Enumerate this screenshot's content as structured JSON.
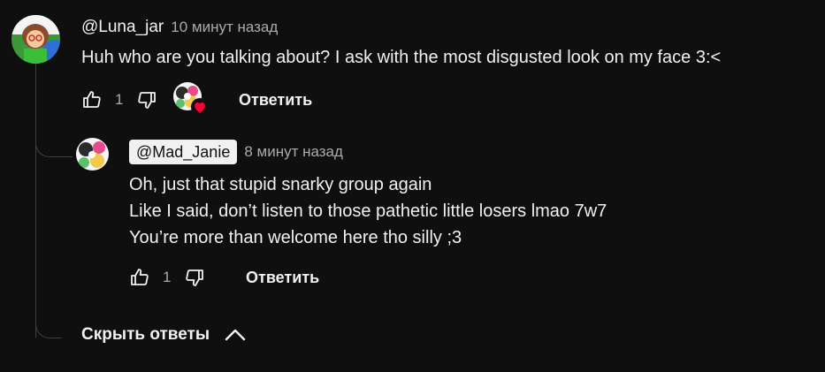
{
  "comment": {
    "handle": "@Luna_jar",
    "time": "10 минут назад",
    "text": "Huh who are you talking about? I ask with the most disgusted look on my face 3:<",
    "likes": "1",
    "reply_label": "Ответить"
  },
  "reply": {
    "handle": "@Mad_Janie",
    "time": "8 минут назад",
    "lines": [
      "Oh, just that stupid snarky group again",
      "Like I said, don’t listen to those pathetic little losers lmao 7w7",
      "You’re more than welcome here tho silly ;3"
    ],
    "likes": "1",
    "reply_label": "Ответить"
  },
  "hide_replies_label": "Скрыть ответы",
  "icons": {
    "like": "thumbs-up-icon",
    "dislike": "thumbs-down-icon",
    "heart": "heart-icon",
    "chevron": "chevron-up-icon"
  },
  "colors": {
    "background": "#0f0f0f",
    "text": "#f1f1f1",
    "secondary": "#aaaaaa",
    "heart": "#ff0033"
  }
}
